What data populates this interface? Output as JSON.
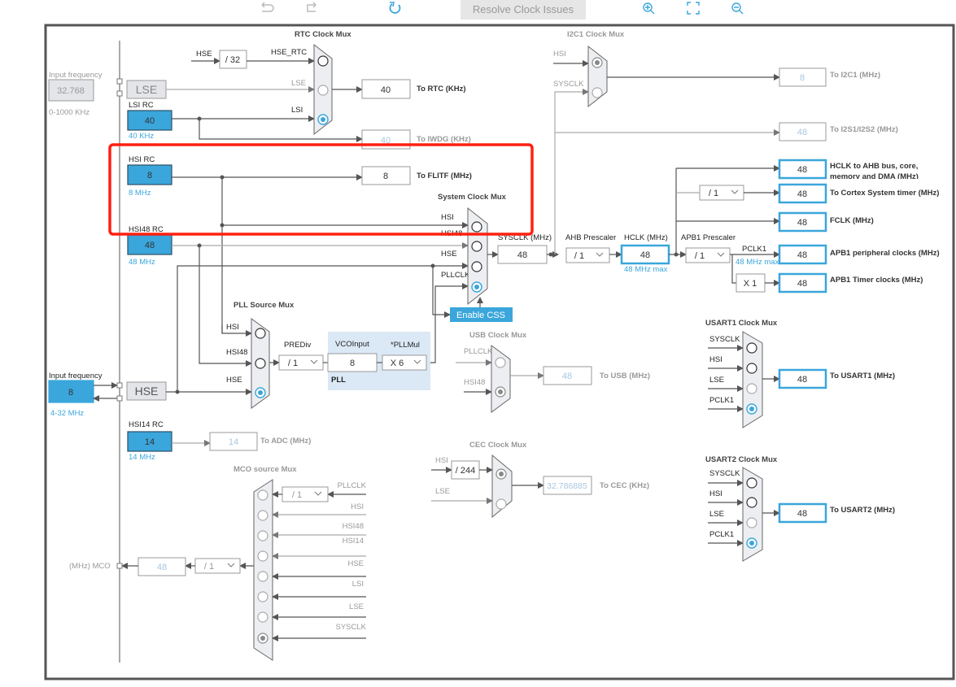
{
  "toolbar": {
    "resolve_label": "Resolve Clock Issues",
    "icons": [
      "undo-icon",
      "redo-icon",
      "refresh-icon",
      "zoom-in-icon",
      "fit-icon",
      "zoom-out-icon"
    ]
  },
  "colors": {
    "accent": "#3aa6db",
    "highlight": "#ff2010",
    "disabled_text": "#a9c6de"
  },
  "lse_input": {
    "label": "Input frequency",
    "value": "32.768",
    "range": "0-1000 KHz",
    "source": "LSE"
  },
  "lsi": {
    "label": "LSI RC",
    "value": "40",
    "unit": "40 KHz"
  },
  "hsi": {
    "label": "HSI RC",
    "value": "8",
    "unit": "8 MHz"
  },
  "hsi48": {
    "label": "HSI48 RC",
    "value": "48",
    "unit": "48 MHz"
  },
  "hse_input": {
    "label": "Input frequency",
    "value": "8",
    "range": "4-32 MHz",
    "source": "HSE"
  },
  "hsi14": {
    "label": "HSI14 RC",
    "value": "14",
    "unit": "14 MHz",
    "adc_value": "14",
    "adc_label": "To ADC (MHz)"
  },
  "rtc_mux": {
    "title": "RTC Clock Mux",
    "hse": "HSE",
    "div": "/ 32",
    "inputs": [
      "HSE_RTC",
      "LSE",
      "LSI"
    ],
    "selected": "LSI",
    "rtc_value": "40",
    "rtc_label": "To RTC (KHz)",
    "iwdg_value": "40",
    "iwdg_label": "To IWDG (KHz)"
  },
  "flitf": {
    "value": "8",
    "label": "To FLITF (MHz)"
  },
  "sys_mux": {
    "title": "System Clock Mux",
    "inputs": [
      "HSI",
      "HSI48",
      "HSE",
      "PLLCLK"
    ],
    "selected": "PLLCLK",
    "enable_css": "Enable CSS"
  },
  "sysclk": {
    "label": "SYSCLK (MHz)",
    "value": "48"
  },
  "ahb": {
    "label": "AHB Prescaler",
    "value": "/ 1"
  },
  "hclk": {
    "label": "HCLK (MHz)",
    "value": "48",
    "max": "48 MHz max"
  },
  "apb1": {
    "label": "APB1 Prescaler",
    "value": "/ 1",
    "pclk1": "PCLK1",
    "max": "48 MHz max",
    "timer_mult": "X 1"
  },
  "cortex_div": "/ 1",
  "outputs": {
    "hclk_ahb": {
      "value": "48",
      "label_line1": "HCLK to AHB bus, core,",
      "label_line2": "memory and DMA (MHz)"
    },
    "cortex": {
      "value": "48",
      "label": "To Cortex System timer (MHz)"
    },
    "fclk": {
      "value": "48",
      "label": "FCLK (MHz)"
    },
    "apb1_periph": {
      "value": "48",
      "label": "APB1 peripheral clocks (MHz)"
    },
    "apb1_timer": {
      "value": "48",
      "label": "APB1 Timer clocks (MHz)"
    }
  },
  "i2c1_mux": {
    "title": "I2C1 Clock Mux",
    "inputs": [
      "HSI",
      "SYSCLK"
    ],
    "selected": "HSI",
    "value": "8",
    "label": "To I2C1 (MHz)"
  },
  "i2s": {
    "value": "48",
    "label": "To I2S1/I2S2 (MHz)"
  },
  "pll": {
    "src_title": "PLL Source Mux",
    "inputs": [
      "HSI",
      "HSI48",
      "HSE"
    ],
    "selected": "HSE",
    "prediv_label": "PREDiv",
    "prediv": "/ 1",
    "vco_label": "VCOInput",
    "vco": "8",
    "mul_label": "*PLLMul",
    "mul": "X 6",
    "name": "PLL"
  },
  "usb_mux": {
    "title": "USB Clock Mux",
    "inputs": [
      "PLLCLK",
      "HSI48"
    ],
    "selected": "HSI48",
    "value": "48",
    "label": "To USB (MHz)"
  },
  "cec_mux": {
    "title": "CEC Clock Mux",
    "inputs": [
      "HSI",
      "LSE"
    ],
    "div": "/ 244",
    "selected": "HSI",
    "value": "32.786885",
    "label": "To CEC (KHz)"
  },
  "mco": {
    "title": "MCO source Mux",
    "inputs": [
      "PLLCLK",
      "HSI",
      "HSI48",
      "HSI14",
      "HSE",
      "LSI",
      "LSE",
      "SYSCLK"
    ],
    "selected": "SYSCLK",
    "pll_div": "/ 1",
    "div": "/ 1",
    "value": "48",
    "label": "(MHz) MCO"
  },
  "usart1_mux": {
    "title": "USART1 Clock Mux",
    "inputs": [
      "SYSCLK",
      "HSI",
      "LSE",
      "PCLK1"
    ],
    "selected": "PCLK1",
    "value": "48",
    "label": "To USART1 (MHz)"
  },
  "usart2_mux": {
    "title": "USART2 Clock Mux",
    "inputs": [
      "SYSCLK",
      "HSI",
      "LSE",
      "PCLK1"
    ],
    "selected": "PCLK1",
    "value": "48",
    "label": "To USART2 (MHz)"
  }
}
